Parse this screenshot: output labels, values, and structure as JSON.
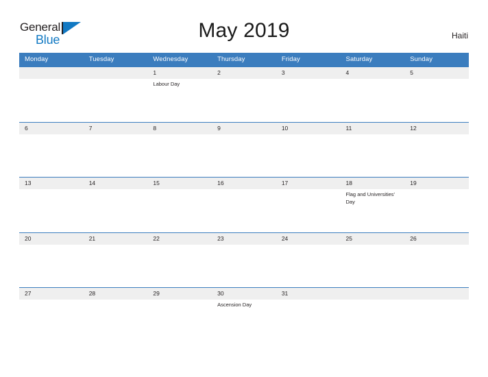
{
  "brand": {
    "name_part1": "General",
    "name_part2": "Blue",
    "flag_icon": "flag-triangle-icon",
    "color_primary": "#1279c3",
    "color_text": "#231f20"
  },
  "header": {
    "title": "May 2019",
    "locale": "Haiti"
  },
  "colors": {
    "header_blue": "#3b7dbe",
    "row_gray": "#efefef",
    "grid_line": "#3b7dbe",
    "text": "#231f20"
  },
  "calendar": {
    "month": "May",
    "year": "2019",
    "weekday_headers": [
      "Monday",
      "Tuesday",
      "Wednesday",
      "Thursday",
      "Friday",
      "Saturday",
      "Sunday"
    ],
    "weeks": [
      [
        {
          "date": "",
          "event": ""
        },
        {
          "date": "",
          "event": ""
        },
        {
          "date": "1",
          "event": "Labour Day"
        },
        {
          "date": "2",
          "event": ""
        },
        {
          "date": "3",
          "event": ""
        },
        {
          "date": "4",
          "event": ""
        },
        {
          "date": "5",
          "event": ""
        }
      ],
      [
        {
          "date": "6",
          "event": ""
        },
        {
          "date": "7",
          "event": ""
        },
        {
          "date": "8",
          "event": ""
        },
        {
          "date": "9",
          "event": ""
        },
        {
          "date": "10",
          "event": ""
        },
        {
          "date": "11",
          "event": ""
        },
        {
          "date": "12",
          "event": ""
        }
      ],
      [
        {
          "date": "13",
          "event": ""
        },
        {
          "date": "14",
          "event": ""
        },
        {
          "date": "15",
          "event": ""
        },
        {
          "date": "16",
          "event": ""
        },
        {
          "date": "17",
          "event": ""
        },
        {
          "date": "18",
          "event": "Flag and Universities' Day"
        },
        {
          "date": "19",
          "event": ""
        }
      ],
      [
        {
          "date": "20",
          "event": ""
        },
        {
          "date": "21",
          "event": ""
        },
        {
          "date": "22",
          "event": ""
        },
        {
          "date": "23",
          "event": ""
        },
        {
          "date": "24",
          "event": ""
        },
        {
          "date": "25",
          "event": ""
        },
        {
          "date": "26",
          "event": ""
        }
      ],
      [
        {
          "date": "27",
          "event": ""
        },
        {
          "date": "28",
          "event": ""
        },
        {
          "date": "29",
          "event": ""
        },
        {
          "date": "30",
          "event": "Ascension Day"
        },
        {
          "date": "31",
          "event": ""
        },
        {
          "date": "",
          "event": ""
        },
        {
          "date": "",
          "event": ""
        }
      ]
    ]
  }
}
